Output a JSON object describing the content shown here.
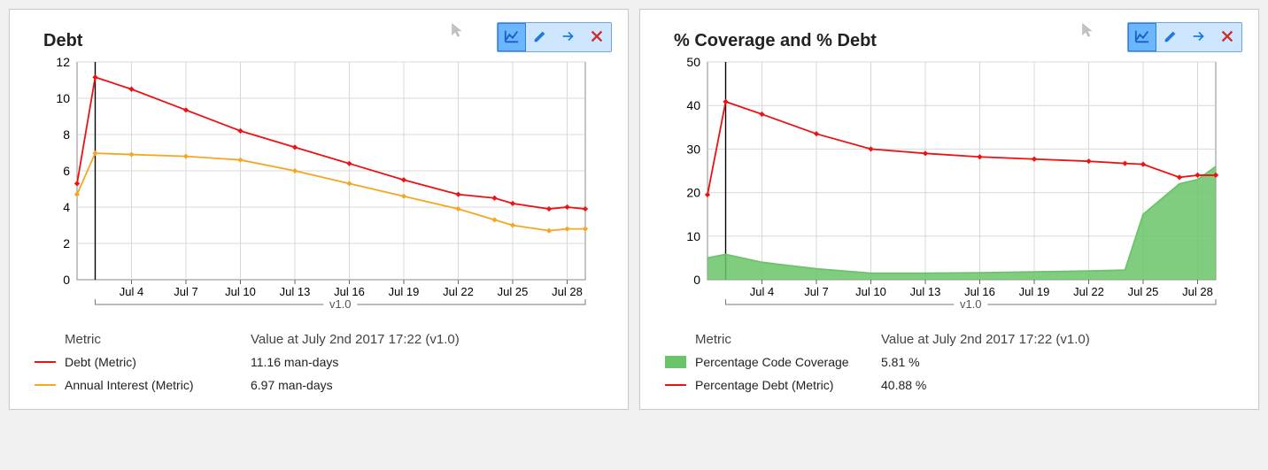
{
  "toolbar": {
    "icons": [
      "chart-line-icon",
      "pencil-icon",
      "arrow-right-icon",
      "close-icon"
    ],
    "selected": 0
  },
  "panels": [
    {
      "title": "Debt",
      "legend_headers": {
        "metric": "Metric",
        "value": "Value at July 2nd 2017  17:22  (v1.0)"
      },
      "legend_rows": [
        {
          "swatch": {
            "type": "line",
            "color": "#e11"
          },
          "metric": "Debt (Metric)",
          "value": "11.16 man-days"
        },
        {
          "swatch": {
            "type": "line",
            "color": "#f5a623"
          },
          "metric": "Annual Interest (Metric)",
          "value": "6.97 man-days"
        }
      ]
    },
    {
      "title": "% Coverage and % Debt",
      "legend_headers": {
        "metric": "Metric",
        "value": "Value at July 2nd 2017  17:22  (v1.0)"
      },
      "legend_rows": [
        {
          "swatch": {
            "type": "area",
            "color": "#6ac46a"
          },
          "metric": "Percentage Code Coverage",
          "value": "5.81 %"
        },
        {
          "swatch": {
            "type": "line",
            "color": "#e11"
          },
          "metric": "Percentage Debt (Metric)",
          "value": "40.88 %"
        }
      ]
    }
  ],
  "chart_data": [
    {
      "type": "line",
      "title": "Debt",
      "xlabel": "",
      "ylabel": "",
      "ylim": [
        0,
        12
      ],
      "x_ticks": [
        "Jul 4",
        "Jul 7",
        "Jul 10",
        "Jul 13",
        "Jul 16",
        "Jul 19",
        "Jul 22",
        "Jul 25",
        "Jul 28"
      ],
      "x_dates": [
        "Jul 1",
        "Jul 2",
        "Jul 4",
        "Jul 7",
        "Jul 10",
        "Jul 13",
        "Jul 16",
        "Jul 19",
        "Jul 22",
        "Jul 24",
        "Jul 25",
        "Jul 27",
        "Jul 28",
        "Jul 29"
      ],
      "x_numeric": [
        1,
        2,
        4,
        7,
        10,
        13,
        16,
        19,
        22,
        24,
        25,
        27,
        28,
        29
      ],
      "series": [
        {
          "name": "Debt (Metric)",
          "color": "#e11",
          "marker": "diamond",
          "values": [
            5.3,
            11.16,
            10.5,
            9.35,
            8.2,
            7.3,
            6.4,
            5.5,
            4.7,
            4.5,
            4.2,
            3.9,
            4.0,
            3.9
          ]
        },
        {
          "name": "Annual Interest (Metric)",
          "color": "#f5a623",
          "marker": "diamond",
          "values": [
            4.7,
            6.97,
            6.9,
            6.8,
            6.6,
            6.0,
            5.3,
            4.6,
            3.9,
            3.3,
            3.0,
            2.7,
            2.8,
            2.8
          ]
        }
      ],
      "range_marker": {
        "label": "v1.0",
        "from": 2,
        "to": 29
      }
    },
    {
      "type": "line",
      "title": "% Coverage and % Debt",
      "xlabel": "",
      "ylabel": "",
      "ylim": [
        0,
        50
      ],
      "x_ticks": [
        "Jul 4",
        "Jul 7",
        "Jul 10",
        "Jul 13",
        "Jul 16",
        "Jul 19",
        "Jul 22",
        "Jul 25",
        "Jul 28"
      ],
      "x_dates": [
        "Jul 1",
        "Jul 2",
        "Jul 4",
        "Jul 7",
        "Jul 10",
        "Jul 13",
        "Jul 16",
        "Jul 19",
        "Jul 22",
        "Jul 24",
        "Jul 25",
        "Jul 27",
        "Jul 28",
        "Jul 29"
      ],
      "x_numeric": [
        1,
        2,
        4,
        7,
        10,
        13,
        16,
        19,
        22,
        24,
        25,
        27,
        28,
        29
      ],
      "series": [
        {
          "name": "Percentage Code Coverage",
          "color": "#6ac46a",
          "fill": true,
          "marker": null,
          "values": [
            5.0,
            5.81,
            4.0,
            2.5,
            1.5,
            1.5,
            1.6,
            1.8,
            2.0,
            2.2,
            15.0,
            22.0,
            23.0,
            26.0
          ]
        },
        {
          "name": "Percentage Debt (Metric)",
          "color": "#e11",
          "marker": "diamond",
          "values": [
            19.5,
            40.88,
            38.0,
            33.5,
            30.0,
            29.0,
            28.2,
            27.7,
            27.2,
            26.7,
            26.5,
            23.5,
            24.0,
            24.0
          ]
        }
      ],
      "range_marker": {
        "label": "v1.0",
        "from": 2,
        "to": 29
      }
    }
  ]
}
